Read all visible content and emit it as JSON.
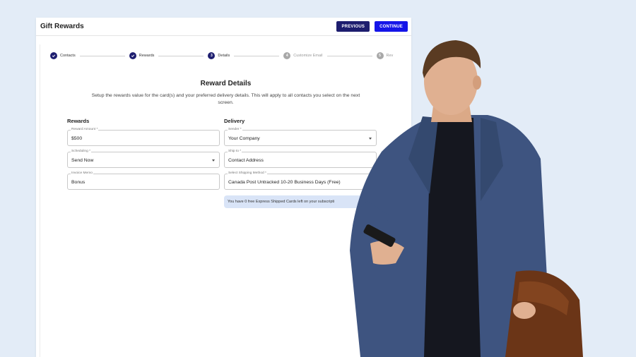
{
  "app": {
    "title": "Gift Rewards",
    "previous_label": "PREVIOUS",
    "continue_label": "CONTINUE"
  },
  "steps": [
    {
      "number": "1",
      "label": "Contacts",
      "state": "done"
    },
    {
      "number": "2",
      "label": "Rewards",
      "state": "done"
    },
    {
      "number": "3",
      "label": "Details",
      "state": "current"
    },
    {
      "number": "4",
      "label": "Customize Email",
      "state": "pending"
    },
    {
      "number": "5",
      "label": "Rev",
      "state": "pending"
    }
  ],
  "main": {
    "title": "Reward Details",
    "description": "Setup the rewards value for the card(s) and your preferred delivery details. This will apply to all contacts you select on the next screen."
  },
  "rewards": {
    "heading": "Rewards",
    "fields": [
      {
        "label": "Reward Amount *",
        "value": "$500"
      },
      {
        "label": "Scheduling *",
        "value": "Send Now"
      },
      {
        "label": "Invoice Memo",
        "value": "Bonus"
      }
    ]
  },
  "delivery": {
    "heading": "Delivery",
    "fields": [
      {
        "label": "Sender *",
        "value": "Your Company"
      },
      {
        "label": "Ship to *",
        "value": "Contact Address"
      },
      {
        "label": "Select Shipping Method *",
        "value": "Canada Post Untracked 10-20 Business Days (Free)"
      }
    ],
    "note": "You have 0 free Express Shipped Cards left on your subscripti"
  },
  "colors": {
    "background": "#e3ecf7",
    "primary_dark": "#1d1d6e",
    "primary_blue": "#1515e8",
    "note_bg": "#d9e4f7"
  },
  "icons": [
    "check-icon",
    "chevron-down-icon"
  ]
}
